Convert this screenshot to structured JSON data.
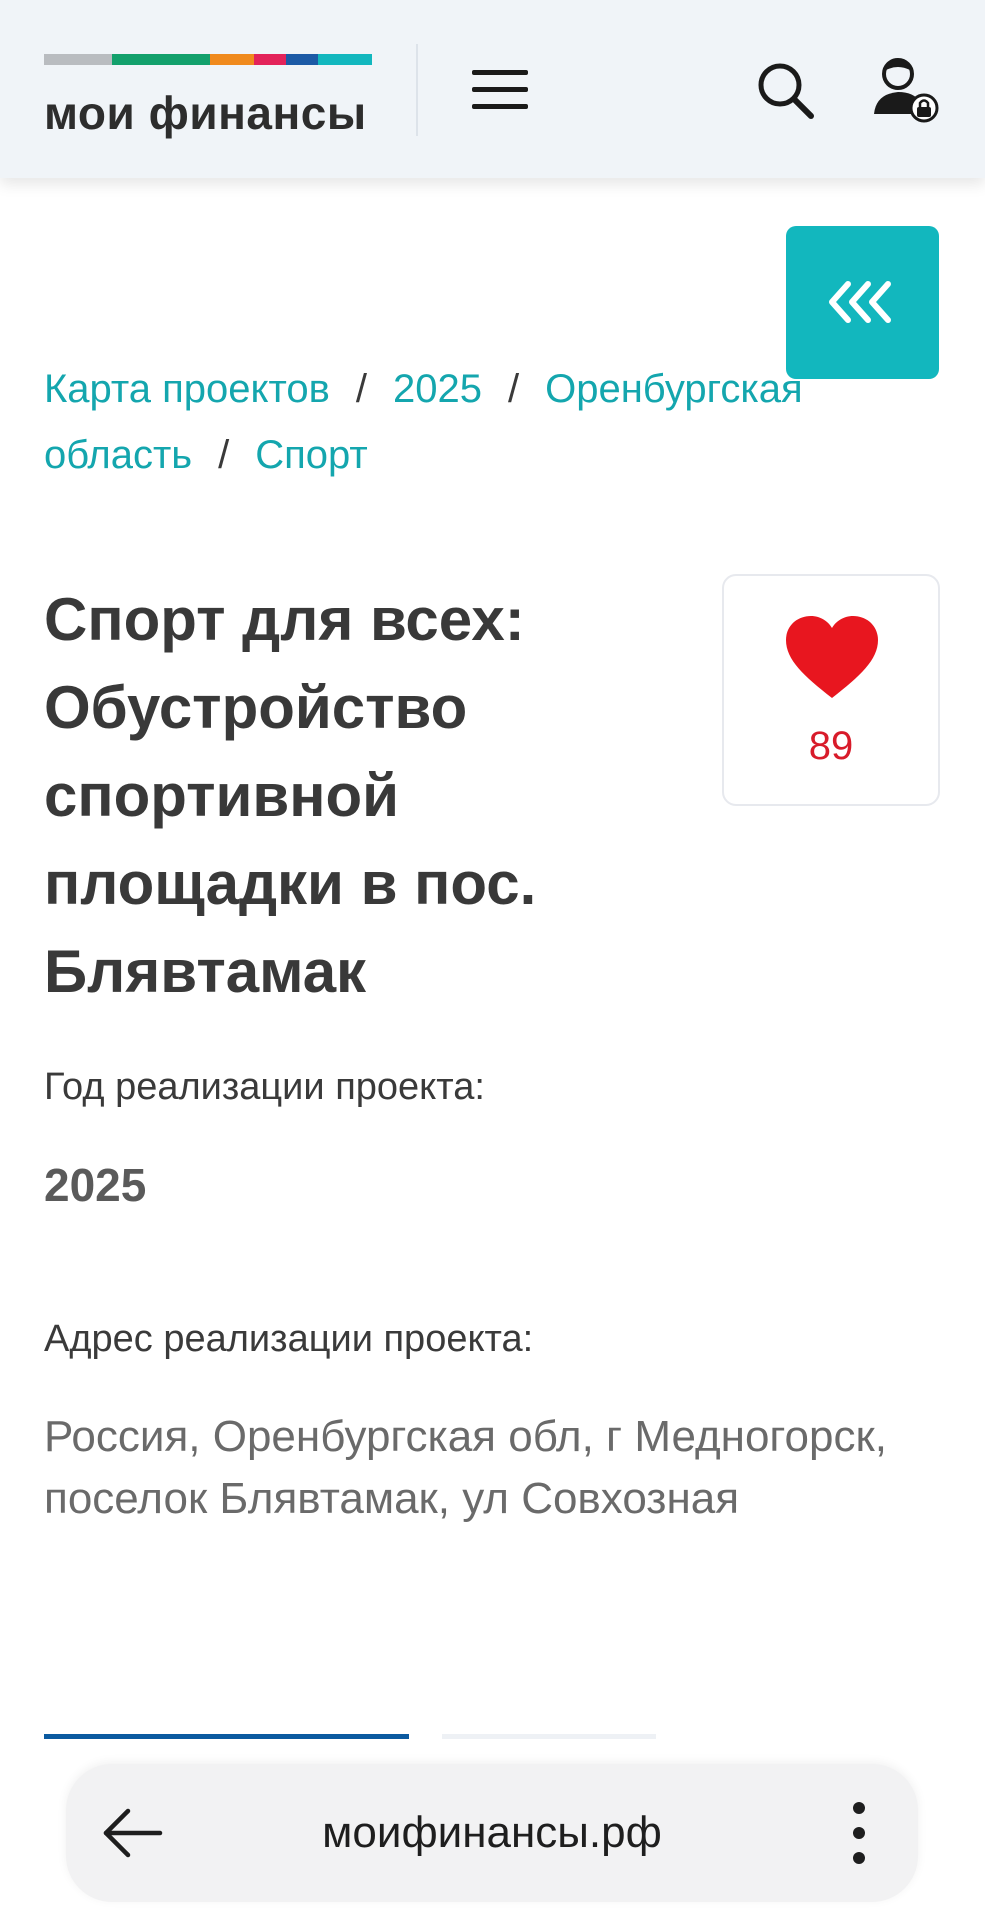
{
  "header": {
    "logo_text": "мои финансы",
    "logo_stripes": [
      "#b9bcc0",
      "#13a06c",
      "#f08a1d",
      "#e3235a",
      "#1c5aa6",
      "#12b7be"
    ]
  },
  "icons": {
    "menu": "hamburger-icon",
    "search": "search-icon",
    "user": "user-lock-icon",
    "collapse": "chevrons-left-icon",
    "like": "heart-icon",
    "back": "arrow-left-icon",
    "more": "more-vertical-icon"
  },
  "breadcrumb": {
    "items": [
      "Карта проектов",
      "2025",
      "Оренбургская область",
      "Спорт"
    ],
    "separator": "/"
  },
  "project": {
    "title": "Спорт для всех: Обустройство спортивной площадки в пос. Блявтамак",
    "likes": "89",
    "year_label": "Год реализации проекта:",
    "year_value": "2025",
    "address_label": "Адрес реализации проекта:",
    "address_value": "Россия, Оренбургская обл, г Медногорск, поселок Блявтамак, ул Совхозная"
  },
  "browser": {
    "url": "моифинансы.рф"
  },
  "colors": {
    "accent": "#12b7be",
    "link": "#14a6ae",
    "heart": "#e8161f",
    "tab_active": "#0b5aa0"
  }
}
